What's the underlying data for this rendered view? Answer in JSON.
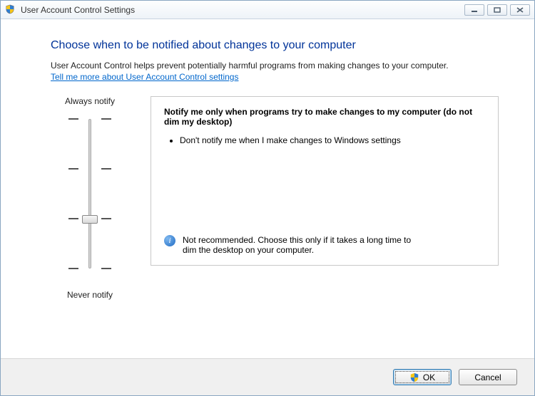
{
  "window": {
    "title": "User Account Control Settings"
  },
  "main": {
    "heading": "Choose when to be notified about changes to your computer",
    "intro": "User Account Control helps prevent potentially harmful programs from making changes to your computer.",
    "help_link": "Tell me more about User Account Control settings",
    "slider": {
      "top_label": "Always notify",
      "bottom_label": "Never notify",
      "levels": 4,
      "current_level_index": 2
    },
    "panel": {
      "title": "Notify me only when programs try to make changes to my computer (do not dim my desktop)",
      "bullets": [
        "Don't notify me when I make changes to Windows settings"
      ],
      "footnote": "Not recommended. Choose this only if it takes a long time to dim the desktop on your computer."
    }
  },
  "buttons": {
    "ok": "OK",
    "cancel": "Cancel"
  },
  "icons": {
    "info_glyph": "i"
  }
}
